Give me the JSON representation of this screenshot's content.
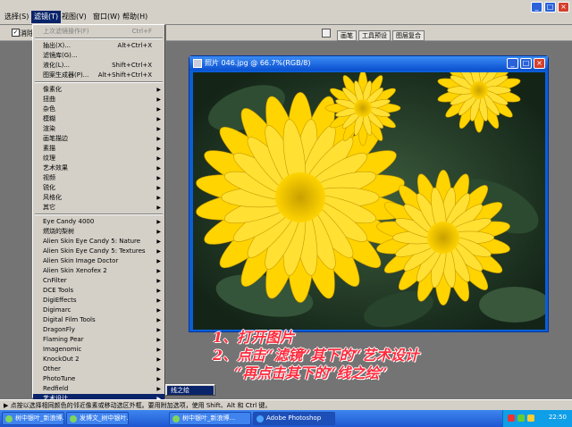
{
  "menubar": {
    "items": [
      "选择(S)",
      "滤镜(T)",
      "视图(V)",
      "窗口(W)",
      "帮助(H)"
    ]
  },
  "options": {
    "checkbox_mark": "✓",
    "checkbox_label": "消除"
  },
  "palette_tabs": [
    "画笔",
    "工具预设",
    "图层复合"
  ],
  "filter_menu": {
    "items": [
      {
        "label": "上次滤镜操作(F)",
        "shortcut": "Ctrl+F",
        "grey": true
      },
      {
        "label": "抽出(X)...",
        "shortcut": "Alt+Ctrl+X"
      },
      {
        "label": "滤镜库(G)..."
      },
      {
        "label": "液化(L)...",
        "shortcut": "Shift+Ctrl+X"
      },
      {
        "label": "图案生成器(P)...",
        "shortcut": "Alt+Shift+Ctrl+X"
      },
      {
        "label": "像素化",
        "sub": true
      },
      {
        "label": "扭曲",
        "sub": true
      },
      {
        "label": "杂色",
        "sub": true
      },
      {
        "label": "模糊",
        "sub": true
      },
      {
        "label": "渲染",
        "sub": true
      },
      {
        "label": "画笔描边",
        "sub": true
      },
      {
        "label": "素描",
        "sub": true
      },
      {
        "label": "纹理",
        "sub": true
      },
      {
        "label": "艺术效果",
        "sub": true
      },
      {
        "label": "视频",
        "sub": true
      },
      {
        "label": "锐化",
        "sub": true
      },
      {
        "label": "风格化",
        "sub": true
      },
      {
        "label": "其它",
        "sub": true
      },
      {
        "label": "Eye Candy 4000",
        "sub": true
      },
      {
        "label": "燃烧的梨树",
        "sub": true
      },
      {
        "label": "Alien Skin Eye Candy 5: Nature",
        "sub": true
      },
      {
        "label": "Alien Skin Eye Candy 5: Textures",
        "sub": true
      },
      {
        "label": "Alien Skin Image Doctor",
        "sub": true
      },
      {
        "label": "Alien Skin Xenofex 2",
        "sub": true
      },
      {
        "label": "CnFilter",
        "sub": true
      },
      {
        "label": "DCE Tools",
        "sub": true
      },
      {
        "label": "DigiEffects",
        "sub": true
      },
      {
        "label": "Digimarc",
        "sub": true
      },
      {
        "label": "Digital Film Tools",
        "sub": true
      },
      {
        "label": "DragonFly",
        "sub": true
      },
      {
        "label": "Flaming Pear",
        "sub": true
      },
      {
        "label": "Imagenomic",
        "sub": true
      },
      {
        "label": "KnockOut 2",
        "sub": true
      },
      {
        "label": "Other",
        "sub": true
      },
      {
        "label": "PhotoTune",
        "sub": true
      },
      {
        "label": "Redfield",
        "sub": true
      },
      {
        "label": "艺术设计",
        "sub": true,
        "selected": true
      }
    ],
    "arrow": "▶"
  },
  "submenu": {
    "item": "线之绘"
  },
  "document": {
    "title": "照片 046.jpg @ 66.7%(RGB/8)"
  },
  "annotation": {
    "line1": "1、打开图片",
    "line2": "2、点击“滤镜”其下的“艺术设计",
    "line3": "“再点击其下的“线之绘”"
  },
  "status": {
    "text": "点按以选择相同颜色的邻近像素或移动选区外框。要用附加选项，使用 Shift、Alt 和 Ctrl 键。",
    "arrow": "▶"
  },
  "taskbar": {
    "buttons": [
      "树中银叶_新浪博...",
      "发博文_树中银叶...",
      "树中银叶_新浪博...",
      "Adobe Photoshop"
    ],
    "clock": "22:50"
  },
  "window_buttons": {
    "min": "_",
    "max": "□",
    "close": "×"
  },
  "colors": {
    "accent": "#0a246a",
    "annotation": "#ff2b3d",
    "petal": "#ffd400"
  }
}
